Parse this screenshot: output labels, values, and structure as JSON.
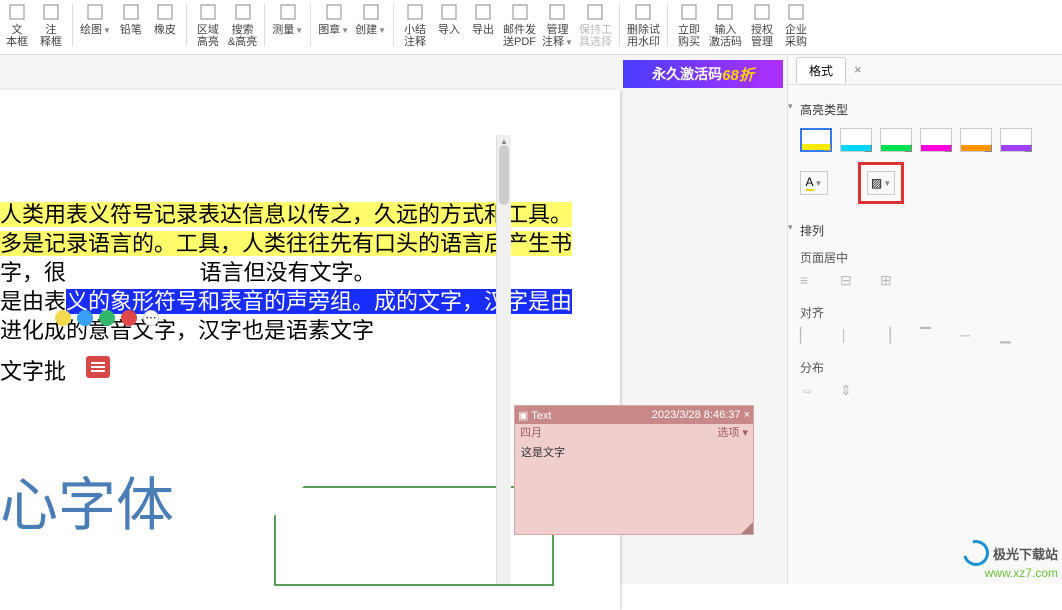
{
  "toolbar": {
    "items": [
      {
        "label": "文\n本框"
      },
      {
        "label": "注\n释框"
      },
      {
        "sep": true
      },
      {
        "label": "绘图",
        "arrow": true
      },
      {
        "label": "铅笔"
      },
      {
        "label": "橡皮"
      },
      {
        "sep": true
      },
      {
        "label": "区域\n高亮"
      },
      {
        "label": "搜索\n&高亮"
      },
      {
        "sep": true
      },
      {
        "label": "测量",
        "arrow": true
      },
      {
        "sep": true
      },
      {
        "label": "图章",
        "arrow": true
      },
      {
        "label": "创建",
        "arrow": true
      },
      {
        "sep": true
      },
      {
        "label": "小结\n注释"
      },
      {
        "label": "导入"
      },
      {
        "label": "导出"
      },
      {
        "label": "邮件发\n送PDF"
      },
      {
        "label": "管理\n注释",
        "arrow": true
      },
      {
        "label": "保持工\n具选择",
        "disabled": true
      },
      {
        "sep": true
      },
      {
        "label": "删除试\n用水印"
      },
      {
        "sep": true
      },
      {
        "label": "立即\n购买"
      },
      {
        "label": "输入\n激活码"
      },
      {
        "label": "授权\n管理"
      },
      {
        "label": "企业\n采购"
      }
    ]
  },
  "promo": {
    "text": "永久激活码",
    "price": "68折"
  },
  "doc": {
    "line1": "人类用表义符号记录表达信息以传之，久远的方式和工具。",
    "line2a": "多是记录语言的。工具，人类往往先有口头的语言后产生书",
    "line3a": "字，很",
    "line3b": "语言但没有文字。",
    "line4a": "是由表",
    "line4b": "义的象形符号和表音的声旁组。成的文字，汉字是由",
    "line5": "进化成的意音文字，汉字也是语素文字",
    "line6": "文字批",
    "bigtext": "心字体"
  },
  "dot_colors": [
    "#f2d94e",
    "#3aa0f5",
    "#33b86b",
    "#e04848",
    "#eee"
  ],
  "sticky": {
    "icon_label": "Text",
    "timestamp": "2023/3/28 8:46:37",
    "author": "四月",
    "options_label": "选项",
    "body": "这是文字"
  },
  "sidebar": {
    "tab": "格式",
    "section1": "高亮类型",
    "swatches": [
      "yellow",
      "cyan",
      "green",
      "magenta",
      "orange",
      "purple"
    ],
    "font_btn": "A",
    "section2": "排列",
    "page_center": "页面居中",
    "align": "对齐",
    "dist": "分布"
  },
  "footer": {
    "brand": "极光下载站",
    "url": "www.xz7.com"
  }
}
